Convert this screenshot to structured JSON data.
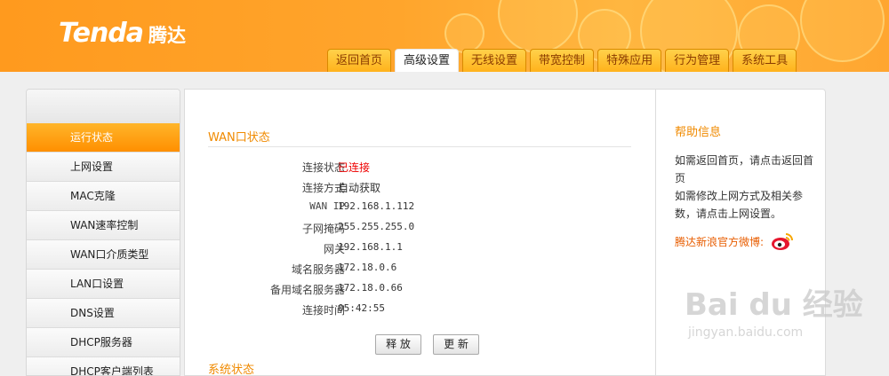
{
  "header": {
    "logo_text": "Tenda",
    "logo_cn": "腾达",
    "tabs": [
      {
        "label": "返回首页"
      },
      {
        "label": "高级设置"
      },
      {
        "label": "无线设置"
      },
      {
        "label": "带宽控制"
      },
      {
        "label": "特殊应用"
      },
      {
        "label": "行为管理"
      },
      {
        "label": "系统工具"
      }
    ],
    "active_tab": "高级设置"
  },
  "sidebar": {
    "items": [
      {
        "label": "运行状态"
      },
      {
        "label": "上网设置"
      },
      {
        "label": "MAC克隆"
      },
      {
        "label": "WAN速率控制"
      },
      {
        "label": "WAN口介质类型"
      },
      {
        "label": "LAN口设置"
      },
      {
        "label": "DNS设置"
      },
      {
        "label": "DHCP服务器"
      },
      {
        "label": "DHCP客户端列表"
      }
    ],
    "active_item": "运行状态"
  },
  "main": {
    "wan_title": "WAN口状态",
    "rows": [
      {
        "label": "连接状态",
        "value": "已连接"
      },
      {
        "label": "连接方式",
        "value": "自动获取"
      },
      {
        "label": "WAN IP",
        "value": "192.168.1.112"
      },
      {
        "label": "子网掩码",
        "value": "255.255.255.0"
      },
      {
        "label": "网关",
        "value": "192.168.1.1"
      },
      {
        "label": "域名服务器",
        "value": "172.18.0.6"
      },
      {
        "label": "备用域名服务器",
        "value": "172.18.0.66"
      },
      {
        "label": "连接时间",
        "value": "05:42:55"
      }
    ],
    "release_button": "释 放",
    "renew_button": "更 新",
    "system_title": "系统状态"
  },
  "help": {
    "title": "帮助信息",
    "text1": "如需返回首页，请点击返回首页",
    "text2": "如需修改上网方式及相关参数，请点击上网设置。",
    "weibo_label": "腾达新浪官方微博:"
  },
  "watermark": {
    "logo": "Bai du 经验",
    "sub": "jingyan.baidu.com"
  },
  "colors": {
    "accent": "#f08a00",
    "connected": "#e00000"
  }
}
